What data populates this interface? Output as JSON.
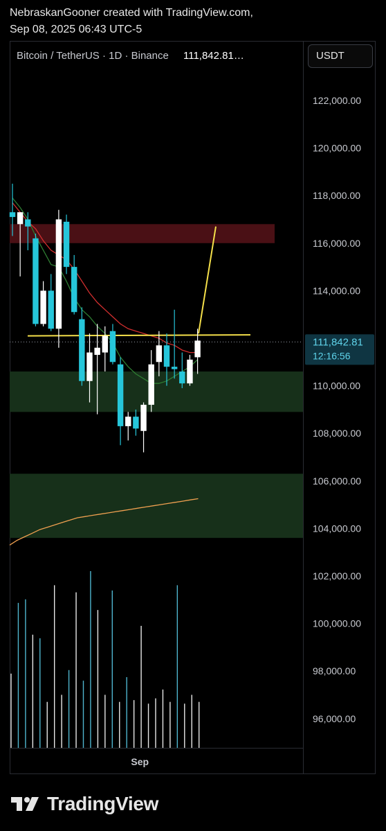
{
  "credit": {
    "line1": "NebraskanGooner created with TradingView.com,",
    "line2": "Sep 08, 2025 06:43 UTC-5"
  },
  "header": {
    "symbol": "Bitcoin / TetherUS · 1D · Binance",
    "price": "111,842.81…"
  },
  "currency_button": "USDT",
  "price_tag": {
    "price": "111,842.81",
    "countdown": "12:16:56"
  },
  "logo": {
    "text": "TradingView",
    "icon": "tradingview-logo-icon"
  },
  "colors": {
    "background": "#000000",
    "up_candle": "#ffffff",
    "down_candle": "#26c6da",
    "resistance_zone": "#4a1015",
    "support_zone": "#17301a",
    "ma_red": "#d32f2f",
    "ma_green": "#2e7d32",
    "ma_orange": "#f0a050",
    "trendline": "#f5e04a"
  },
  "chart_data": {
    "type": "candlestick",
    "title": "Bitcoin / TetherUS · 1D · Binance",
    "ylim": [
      94800,
      123800
    ],
    "y_ticks": [
      122000,
      120000,
      118000,
      116000,
      114000,
      112000,
      110000,
      108000,
      106000,
      104000,
      102000,
      100000,
      98000,
      96000
    ],
    "y_tick_labels": [
      "122,000.00",
      "120,000.00",
      "118,000.00",
      "116,000.00",
      "114,000.00",
      "",
      "110,000.00",
      "108,000.00",
      "106,000.00",
      "104,000.00",
      "102,000.00",
      "100,000.00",
      "98,000.00",
      "96,000.00"
    ],
    "x_ticks": [
      {
        "index": 15,
        "label": "Sep"
      }
    ],
    "candles": [
      {
        "o": 117300,
        "h": 118500,
        "l": 116300,
        "c": 117100
      },
      {
        "o": 116800,
        "h": 117300,
        "l": 114600,
        "c": 117300
      },
      {
        "o": 117000,
        "h": 117300,
        "l": 115700,
        "c": 116700
      },
      {
        "o": 116200,
        "h": 116400,
        "l": 112500,
        "c": 112600
      },
      {
        "o": 112600,
        "h": 114400,
        "l": 112500,
        "c": 114000
      },
      {
        "o": 114000,
        "h": 114700,
        "l": 112300,
        "c": 112400
      },
      {
        "o": 112400,
        "h": 117400,
        "l": 111600,
        "c": 117000
      },
      {
        "o": 116900,
        "h": 117200,
        "l": 114700,
        "c": 115000
      },
      {
        "o": 115000,
        "h": 115500,
        "l": 113000,
        "c": 113100
      },
      {
        "o": 112800,
        "h": 113300,
        "l": 110000,
        "c": 110200
      },
      {
        "o": 110200,
        "h": 112200,
        "l": 109300,
        "c": 111400
      },
      {
        "o": 111300,
        "h": 112600,
        "l": 108800,
        "c": 111600
      },
      {
        "o": 111400,
        "h": 112500,
        "l": 110600,
        "c": 112100
      },
      {
        "o": 112300,
        "h": 112600,
        "l": 110900,
        "c": 111000
      },
      {
        "o": 110900,
        "h": 111200,
        "l": 107500,
        "c": 108300
      },
      {
        "o": 108300,
        "h": 108900,
        "l": 107700,
        "c": 108700
      },
      {
        "o": 108700,
        "h": 109000,
        "l": 107900,
        "c": 108200
      },
      {
        "o": 108100,
        "h": 109300,
        "l": 107200,
        "c": 109200
      },
      {
        "o": 109200,
        "h": 111500,
        "l": 108900,
        "c": 110900
      },
      {
        "o": 111000,
        "h": 112300,
        "l": 110400,
        "c": 111700
      },
      {
        "o": 111700,
        "h": 112200,
        "l": 110000,
        "c": 110800
      },
      {
        "o": 110800,
        "h": 113200,
        "l": 110300,
        "c": 110700
      },
      {
        "o": 110600,
        "h": 111400,
        "l": 109900,
        "c": 110100
      },
      {
        "o": 110100,
        "h": 111300,
        "l": 110000,
        "c": 111100
      },
      {
        "o": 111200,
        "h": 112400,
        "l": 110500,
        "c": 111900
      }
    ],
    "volume": [
      0.42,
      0.82,
      0.84,
      0.64,
      0.62,
      0.26,
      0.92,
      0.3,
      0.44,
      0.88,
      0.38,
      1.0,
      0.78,
      0.3,
      0.89,
      0.26,
      0.4,
      0.27,
      0.69,
      0.25,
      0.28,
      0.33,
      0.26,
      0.92,
      0.25,
      0.3,
      0.26
    ],
    "zones": [
      {
        "type": "resistance",
        "from": 116000,
        "to": 116800
      },
      {
        "type": "support",
        "from": 108900,
        "to": 110600
      },
      {
        "type": "support",
        "from": 103600,
        "to": 106300
      }
    ],
    "horizontal_line": 112100,
    "projection_line": {
      "from_index": 24,
      "from_price": 112200,
      "to_index": 26,
      "to_price": 116700
    },
    "ma_red": [
      117700,
      117300,
      116900,
      116600,
      116100,
      115700,
      115500,
      115300,
      114900,
      114400,
      113900,
      113500,
      113200,
      112900,
      112600,
      112400,
      112300,
      112200,
      112100,
      112000,
      111800,
      111700,
      111500,
      111400,
      111400
    ],
    "ma_green": [
      117900,
      117500,
      117000,
      116300,
      115700,
      115100,
      115000,
      114400,
      113700,
      113200,
      112900,
      112500,
      112200,
      111800,
      111200,
      110800,
      110500,
      110300,
      110100,
      110100,
      110200,
      110400,
      110600,
      110800,
      111100
    ],
    "ma_orange": [
      103300,
      103500,
      103650,
      103800,
      103950,
      104050,
      104150,
      104250,
      104350,
      104450,
      104500,
      104550,
      104600,
      104650,
      104700,
      104750,
      104800,
      104850,
      104900,
      104950,
      105000,
      105050,
      105100,
      105150,
      105200,
      105250
    ]
  }
}
